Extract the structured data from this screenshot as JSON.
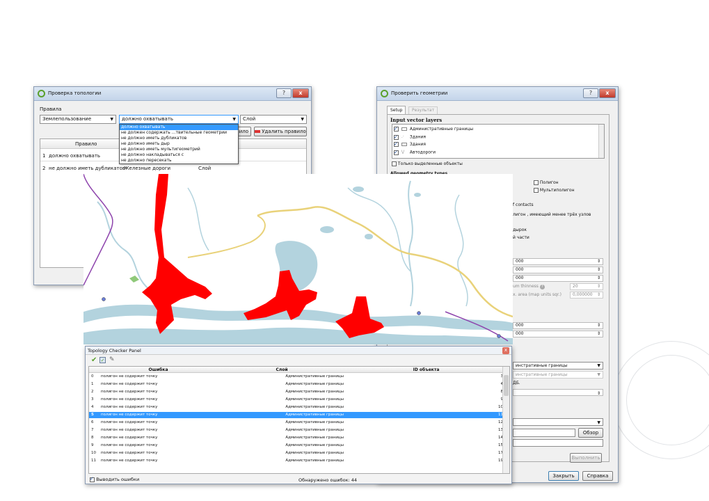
{
  "topology_dialog": {
    "title": "Проверка топологии",
    "rules_label": "Правила",
    "layer_combo": "Землепользование",
    "predicate_combo": "должно охватывать",
    "target_combo": "Слой",
    "dropdown_options": [
      "должно охватывать",
      "не должен содержать ...твительные геометрии",
      "не должно иметь дубликатов",
      "не должно иметь дыр",
      "не должно иметь мультигеометрий",
      "не должно накладываться с",
      "не должно пересекать"
    ],
    "add_rule_partial": "вило",
    "delete_rule_button": "Удалить правило",
    "table_header": "Правило",
    "rules": [
      {
        "n": "1",
        "rule": "должно охватывать",
        "layer2": "",
        "layer3": ""
      },
      {
        "n": "2",
        "rule": "не должно иметь дубликатов",
        "layer2": "Железные дороги",
        "layer3": "Слой"
      }
    ],
    "help_button": "?",
    "close_button": "x"
  },
  "geometry_dialog": {
    "title": "Проверить геометрии",
    "tabs": [
      "Setup",
      "Результат"
    ],
    "input_layers_title": "Input vector layers",
    "layers": [
      {
        "name": "Административные границы",
        "icon": "polygon-icon"
      },
      {
        "name": "Здания",
        "icon": "point-icon"
      },
      {
        "name": "Здания",
        "icon": "polygon-icon"
      },
      {
        "name": "Автодороги",
        "icon": "line-icon"
      }
    ],
    "only_selected": "Только выделенные объекты",
    "allowed_types": "Allowed geometry types",
    "polygon": "Полигон",
    "multipolygon": "Мультиполигон",
    "contacts_text": "f contacts",
    "fewer_nodes_text": "лигон , имеющий менее трёх узлов",
    "holes_text": "дырок",
    "parts_text": "й части",
    "values": [
      "000",
      "000",
      "000"
    ],
    "thinness_label": "um thinness",
    "thinness_value": "20",
    "area_label": "x. area (map units sqr.)",
    "area_value": "0,000000",
    "values2": [
      "000",
      "000"
    ],
    "layer_combo1": "инстративные границы",
    "layer_combo2": "инстративные границы",
    "partial_text": "ДБ.",
    "browse_button": "Обзор",
    "run_button": "Выполнить",
    "close_button": "Закрыть",
    "help_button": "Справка"
  },
  "topology_panel": {
    "title": "Topology Checker Panel",
    "columns": [
      "Ошибка",
      "Слой",
      "ID объекта"
    ],
    "rows": [
      {
        "idx": "0",
        "error": "полигон не содержит точку",
        "layer": "Административные границы",
        "id": "3"
      },
      {
        "idx": "1",
        "error": "полигон не содержит точку",
        "layer": "Административные границы",
        "id": "4"
      },
      {
        "idx": "2",
        "error": "полигон не содержит точку",
        "layer": "Административные границы",
        "id": "8"
      },
      {
        "idx": "3",
        "error": "полигон не содержит точку",
        "layer": "Административные границы",
        "id": "9"
      },
      {
        "idx": "4",
        "error": "полигон не содержит точку",
        "layer": "Административные границы",
        "id": "10"
      },
      {
        "idx": "5",
        "error": "полигон не содержит точку",
        "layer": "Административные границы",
        "id": "11"
      },
      {
        "idx": "6",
        "error": "полигон не содержит точку",
        "layer": "Административные границы",
        "id": "12"
      },
      {
        "idx": "7",
        "error": "полигон не содержит точку",
        "layer": "Административные границы",
        "id": "13"
      },
      {
        "idx": "8",
        "error": "полигон не содержит точку",
        "layer": "Административные границы",
        "id": "14"
      },
      {
        "idx": "9",
        "error": "полигон не содержит точку",
        "layer": "Административные границы",
        "id": "15"
      },
      {
        "idx": "10",
        "error": "полигон не содержит точку",
        "layer": "Административные границы",
        "id": "17"
      },
      {
        "idx": "11",
        "error": "полигон не содержит точку",
        "layer": "Административные границы",
        "id": "19"
      }
    ],
    "selected_index": 5,
    "show_errors_label": "Выводить ошибки",
    "errors_found": "Обнаружено ошибок: 44"
  },
  "colors": {
    "selection": "#3399ff",
    "error_polygon": "#ff0000",
    "water": "#b3d3de",
    "road": "#e9d27a",
    "boundary": "#8e44ad"
  }
}
